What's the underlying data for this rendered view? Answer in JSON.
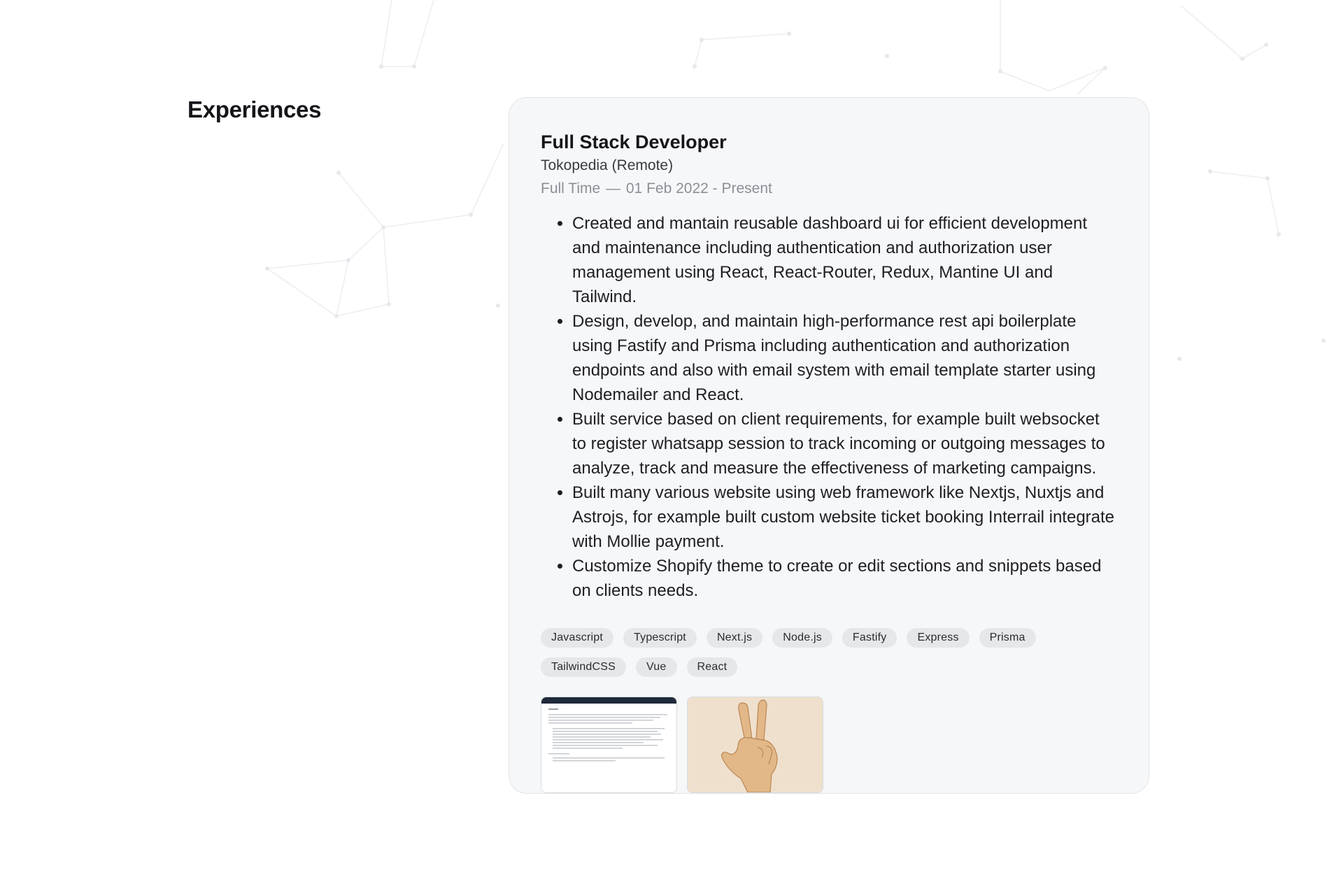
{
  "section": {
    "title": "Experiences"
  },
  "experience": {
    "title": "Full Stack Developer",
    "company": "Tokopedia (Remote)",
    "employment_type": "Full Time",
    "separator": "—",
    "period": "01 Feb 2022 - Present",
    "bullets": [
      "Created and mantain reusable dashboard ui for efficient development and maintenance including authentication and authorization user management using React, React-Router, Redux, Mantine UI and Tailwind.",
      "Design, develop, and maintain high-performance rest api boilerplate using Fastify and Prisma including authentication and authorization endpoints and also with email system with email template starter using Nodemailer and React.",
      "Built service based on client requirements, for example built websocket to register whatsapp session to track incoming or outgoing messages to analyze, track and measure the effectiveness of marketing campaigns.",
      "Built many various website using web framework like Nextjs, Nuxtjs and Astrojs, for example built custom website ticket booking Interrail integrate with Mollie payment.",
      "Customize Shopify theme to create or edit sections and snippets based on clients needs."
    ],
    "tags": [
      "Javascript",
      "Typescript",
      "Next.js",
      "Node.js",
      "Fastify",
      "Express",
      "Prisma",
      "TailwindCSS",
      "Vue",
      "React"
    ],
    "thumbnails": [
      {
        "kind": "document-screenshot"
      },
      {
        "kind": "peace-hand-sign"
      }
    ]
  },
  "colors": {
    "background": "#ffffff",
    "card_background": "#f6f7f8",
    "tag_background": "#e6e7e9",
    "meta_text": "#8b8f96",
    "network_lines": "#ebedf0"
  }
}
